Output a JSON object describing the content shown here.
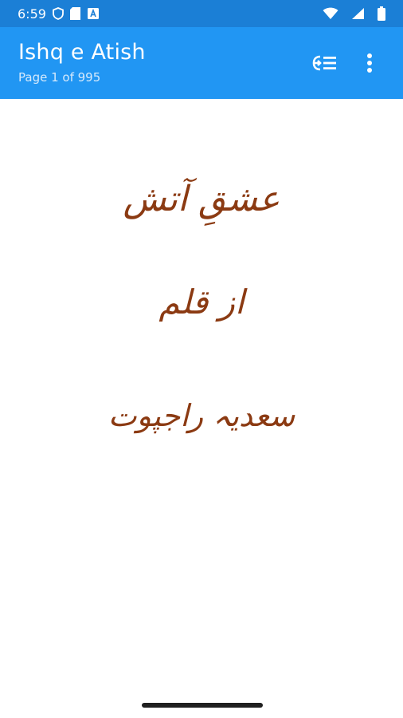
{
  "status_bar": {
    "time": "6:59",
    "icons": [
      "shield-icon",
      "sd-card-icon",
      "a-notification-icon",
      "wifi-icon",
      "signal-icon",
      "battery-icon"
    ]
  },
  "app_bar": {
    "title": "Ishq e Atish",
    "subtitle": "Page 1 of 995",
    "actions": [
      "table-of-contents-icon",
      "more-vertical-icon"
    ]
  },
  "page": {
    "title_urdu": "عشقِ آتش",
    "by_urdu": "از قلم",
    "author_urdu": "سعدیہ راجپوت"
  },
  "colors": {
    "status_bar": "#1b7fd6",
    "app_bar": "#2196f3",
    "urdu_text": "#8b3a12"
  }
}
